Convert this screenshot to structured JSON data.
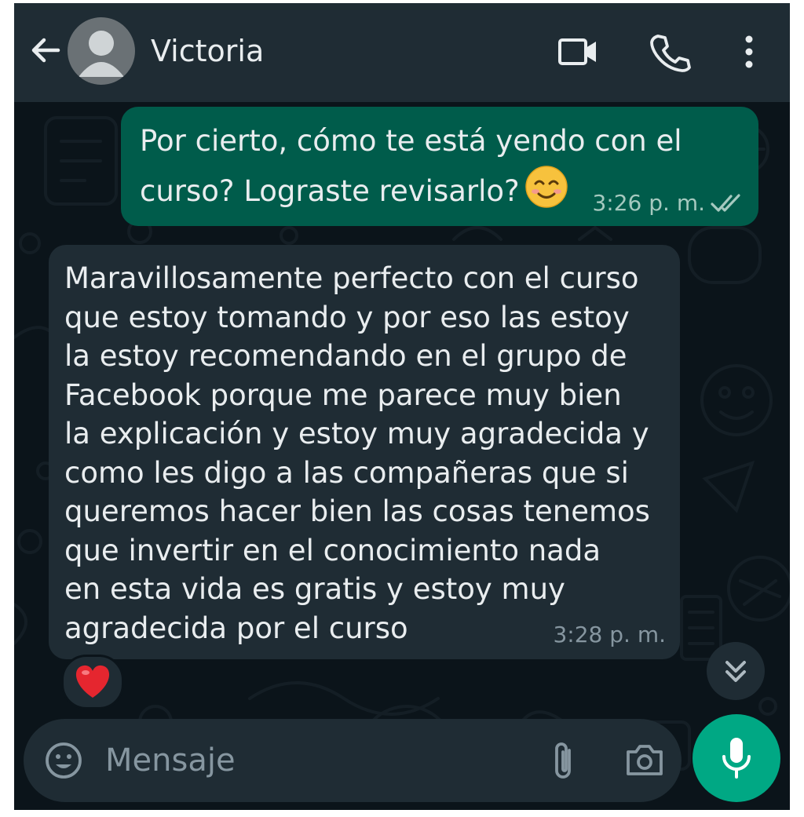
{
  "header": {
    "contact_name": "Victoria",
    "icons": [
      "back-arrow-icon",
      "avatar-placeholder-icon",
      "video-call-icon",
      "voice-call-icon",
      "more-options-icon"
    ]
  },
  "messages": [
    {
      "direction": "outgoing",
      "text": "Por cierto, cómo te está yendo con el curso? Lograste revisarlo?",
      "emoji": "smiling-face-with-smiling-eyes",
      "time": "3:26 p. m.",
      "status": "read"
    },
    {
      "direction": "incoming",
      "text": "Maravillosamente perfecto con el curso\nque estoy tomando y por eso las estoy\nla estoy recomendando en el grupo de\nFacebook porque me parece muy bien\nla explicación y estoy muy agradecida y\ncomo les digo a las compañeras que si\nqueremos hacer bien las cosas tenemos\nque invertir en el conocimiento nada\nen esta vida es gratis y estoy muy\nagradecida por el curso",
      "time": "3:28 p. m.",
      "reaction": "❤️"
    }
  ],
  "composer": {
    "placeholder": "Mensaje",
    "icons": [
      "emoji-icon",
      "attach-icon",
      "camera-icon",
      "mic-icon"
    ]
  },
  "colors": {
    "background": "#0b141a",
    "header": "#1f2c34",
    "outgoing_bubble": "#005c4b",
    "incoming_bubble": "#1f2c34",
    "accent": "#00a884"
  }
}
